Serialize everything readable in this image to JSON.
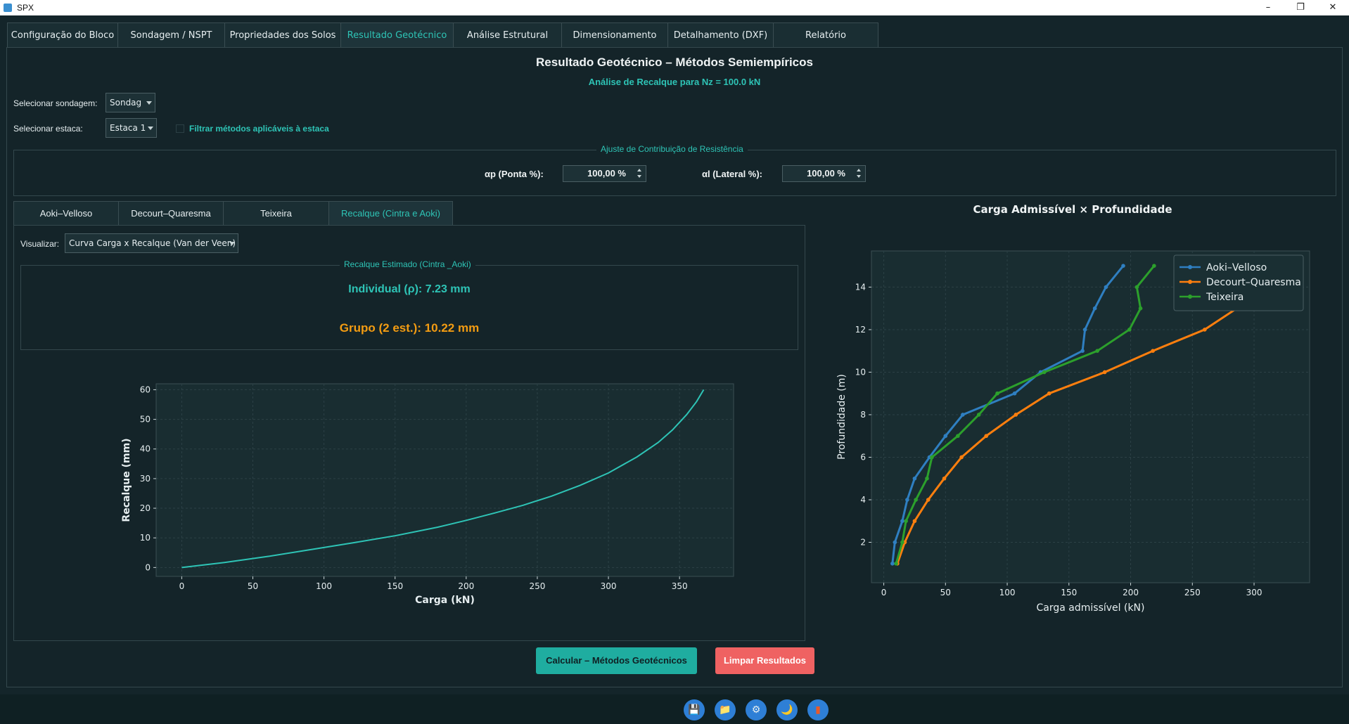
{
  "window": {
    "title": "SPX",
    "minimize": "–",
    "maximize": "❐",
    "close": "✕"
  },
  "main_tabs": [
    "Configuração do Bloco",
    "Sondagem / NSPT",
    "Propriedades dos Solos",
    "Resultado Geotécnico",
    "Análise Estrutural",
    "Dimensionamento",
    "Detalhamento (DXF)",
    "Relatório"
  ],
  "main_tabs_active": 3,
  "header": {
    "title": "Resultado Geotécnico – Métodos Semiempíricos",
    "subtitle": "Análise de Recalque para Nz = 100.0 kN"
  },
  "controls": {
    "sondagem_label": "Selecionar sondagem:",
    "sondagem_value": "Sondag",
    "estaca_label": "Selecionar estaca:",
    "estaca_value": "Estaca 1",
    "filter_label": "Filtrar métodos aplicáveis à estaca"
  },
  "resistance": {
    "group_title": "Ajuste de Contribuição de Resistência",
    "ap_label": "αp (Ponta %):",
    "ap_value": "100,00 %",
    "al_label": "αl (Lateral %):",
    "al_value": "100,00 %"
  },
  "sub_tabs": [
    "Aoki–Velloso",
    "Decourt–Quaresma",
    "Teixeira",
    "Recalque (Cintra e Aoki)"
  ],
  "sub_tabs_active": 3,
  "recalque": {
    "visualizar_label": "Visualizar:",
    "visualizar_value": "Curva Carga x Recalque (Van der Veen)",
    "group_title": "Recalque Estimado (Cintra _Aoki)",
    "individual": "Individual (ρ): 7.23 mm",
    "grupo": "Grupo (2 est.): 10.22 mm"
  },
  "buttons": {
    "calc": "Calcular – Métodos Geotécnicos",
    "clear": "Limpar Resultados"
  },
  "toolbar_icons": [
    "save-icon",
    "folder-icon",
    "settings-icon",
    "moon-icon",
    "exit-icon"
  ],
  "toolbar_glyphs": [
    "💾",
    "📁",
    "⚙",
    "🌙",
    "▮"
  ],
  "colors": {
    "accent": "#2ec4b6",
    "orange": "#f39c12",
    "calc_button": "#1fada0",
    "clear_button": "#ef6262"
  },
  "chart_data": [
    {
      "type": "line",
      "xlabel": "Carga (kN)",
      "ylabel": "Recalque (mm)",
      "xlim": [
        -18,
        388
      ],
      "ylim": [
        62,
        -3
      ],
      "y_inverted": true,
      "xticks": [
        0,
        50,
        100,
        150,
        200,
        250,
        300,
        350
      ],
      "yticks": [
        0,
        10,
        20,
        30,
        40,
        50,
        60
      ],
      "grid": true,
      "series": [
        {
          "color": "#2ec4b6",
          "x": [
            0,
            30,
            60,
            90,
            120,
            150,
            180,
            200,
            220,
            240,
            260,
            280,
            300,
            320,
            335,
            345,
            355,
            362,
            367
          ],
          "y": [
            0,
            1.7,
            3.7,
            6.0,
            8.3,
            10.7,
            13.6,
            15.9,
            18.4,
            21.0,
            24.1,
            27.7,
            31.9,
            37.3,
            42.2,
            46.4,
            51.6,
            56.0,
            60
          ]
        }
      ]
    },
    {
      "type": "line",
      "title": "Carga Admissível × Profundidade",
      "xlabel": "Carga admissível (kN)",
      "ylabel": "Profundidade (m)",
      "xlim": [
        -10,
        345
      ],
      "ylim": [
        15.7,
        0.1
      ],
      "y_inverted": true,
      "xticks": [
        0,
        50,
        100,
        150,
        200,
        250,
        300
      ],
      "yticks": [
        2,
        4,
        6,
        8,
        10,
        12,
        14
      ],
      "grid": true,
      "legend": "top-right",
      "series": [
        {
          "name": "Aoki–Velloso",
          "color": "#2f7fc1",
          "x": [
            7,
            9,
            15,
            19,
            25,
            37,
            50,
            64,
            106,
            127,
            161,
            163,
            171,
            180,
            194
          ],
          "y": [
            1,
            2,
            3,
            4,
            5,
            6,
            7,
            8,
            9,
            10,
            11,
            12,
            13,
            14,
            15
          ]
        },
        {
          "name": "Decourt–Quaresma",
          "color": "#ff7f0e",
          "x": [
            11,
            17,
            25,
            36,
            49,
            63,
            83,
            107,
            134,
            179,
            218,
            260,
            286,
            310,
            333
          ],
          "y": [
            1,
            2,
            3,
            4,
            5,
            6,
            7,
            8,
            9,
            10,
            11,
            12,
            13,
            14,
            15
          ]
        },
        {
          "name": "Teixeira",
          "color": "#2ca02c",
          "x": [
            10,
            15,
            18,
            26,
            35,
            39,
            60,
            77,
            92,
            130,
            173,
            199,
            208,
            205,
            219
          ],
          "y": [
            1,
            2,
            3,
            4,
            5,
            6,
            7,
            8,
            9,
            10,
            11,
            12,
            13,
            14,
            15
          ]
        }
      ]
    }
  ]
}
